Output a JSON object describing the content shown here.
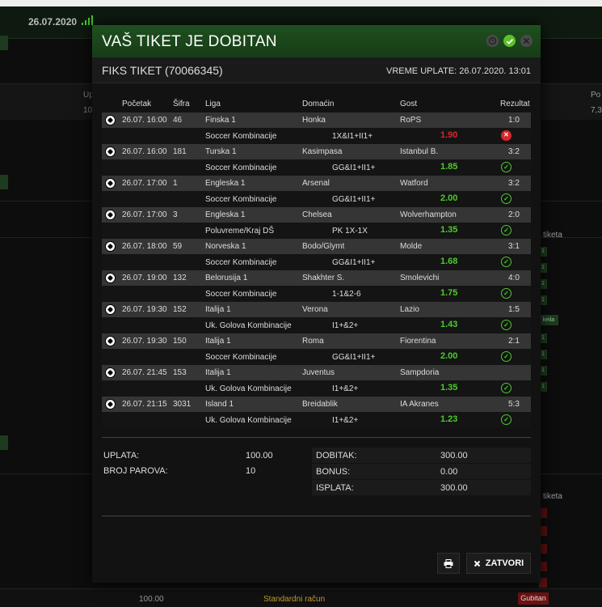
{
  "background": {
    "date": "26.07.2020",
    "left_labels": [
      "Up",
      "10"
    ],
    "right_labels": [
      "Po",
      "7,3"
    ],
    "side_label_1": "tiketa",
    "side_label_2": "tiketa",
    "side_badge": "keila",
    "bottom_amount": "100.00",
    "bottom_account": "Standardni račun",
    "bottom_status": "Gubitan"
  },
  "modal": {
    "title": "VAŠ TIKET JE DOBITAN",
    "ticket_name": "FIKS TIKET (70066345)",
    "payment_time": "VREME UPLATE: 26.07.2020. 13:01",
    "columns": {
      "start": "Početak",
      "code": "Šifra",
      "league": "Liga",
      "home": "Domaćin",
      "away": "Gost",
      "result": "Rezultat"
    },
    "matches": [
      {
        "start": "26.07. 16:00",
        "code": "46",
        "league": "Finska 1",
        "home": "Honka",
        "away": "RoPS",
        "result": "1:0",
        "bet_type": "Soccer Kombinacije",
        "pick": "1X&I1+II1+",
        "odd": "1.90",
        "won": false
      },
      {
        "start": "26.07. 16:00",
        "code": "181",
        "league": "Turska 1",
        "home": "Kasimpasa",
        "away": "Istanbul B.",
        "result": "3:2",
        "bet_type": "Soccer Kombinacije",
        "pick": "GG&I1+II1+",
        "odd": "1.85",
        "won": true
      },
      {
        "start": "26.07. 17:00",
        "code": "1",
        "league": "Engleska 1",
        "home": "Arsenal",
        "away": "Watford",
        "result": "3:2",
        "bet_type": "Soccer Kombinacije",
        "pick": "GG&I1+II1+",
        "odd": "2.00",
        "won": true
      },
      {
        "start": "26.07. 17:00",
        "code": "3",
        "league": "Engleska 1",
        "home": "Chelsea",
        "away": "Wolverhampton",
        "result": "2:0",
        "bet_type": "Poluvreme/Kraj DŠ",
        "pick": "PK 1X-1X",
        "odd": "1.35",
        "won": true
      },
      {
        "start": "26.07. 18:00",
        "code": "59",
        "league": "Norveska 1",
        "home": "Bodo/Glymt",
        "away": "Molde",
        "result": "3:1",
        "bet_type": "Soccer Kombinacije",
        "pick": "GG&I1+II1+",
        "odd": "1.68",
        "won": true
      },
      {
        "start": "26.07. 19:00",
        "code": "132",
        "league": "Belorusija 1",
        "home": "Shakhter S.",
        "away": "Smolevichi",
        "result": "4:0",
        "bet_type": "Soccer Kombinacije",
        "pick": "1-1&2-6",
        "odd": "1.75",
        "won": true
      },
      {
        "start": "26.07. 19:30",
        "code": "152",
        "league": "Italija 1",
        "home": "Verona",
        "away": "Lazio",
        "result": "1:5",
        "bet_type": "Uk. Golova Kombinacije",
        "pick": "I1+&2+",
        "odd": "1.43",
        "won": true
      },
      {
        "start": "26.07. 19:30",
        "code": "150",
        "league": "Italija 1",
        "home": "Roma",
        "away": "Fiorentina",
        "result": "2:1",
        "bet_type": "Soccer Kombinacije",
        "pick": "GG&I1+II1+",
        "odd": "2.00",
        "won": true
      },
      {
        "start": "26.07. 21:45",
        "code": "153",
        "league": "Italija 1",
        "home": "Juventus",
        "away": "Sampdoria",
        "result": "",
        "bet_type": "Uk. Golova Kombinacije",
        "pick": "I1+&2+",
        "odd": "1.35",
        "won": true
      },
      {
        "start": "26.07. 21:15",
        "code": "3031",
        "league": "Island 1",
        "home": "Breidablik",
        "away": "IA Akranes",
        "result": "5:3",
        "bet_type": "Uk. Golova Kombinacije",
        "pick": "I1+&2+",
        "odd": "1.23",
        "won": true
      }
    ],
    "summary": {
      "stake_label": "UPLATA:",
      "stake_value": "100.00",
      "pairs_label": "BROJ PAROVA:",
      "pairs_value": "10",
      "win_label": "DOBITAK:",
      "win_value": "300.00",
      "bonus_label": "BONUS:",
      "bonus_value": "0.00",
      "payout_label": "ISPLATA:",
      "payout_value": "300.00"
    },
    "close_label": "ZATVORI"
  },
  "colors": {
    "win_green": "#4ccb2c",
    "lose_red": "#d9262c",
    "header_green": "#1f4f1f"
  }
}
